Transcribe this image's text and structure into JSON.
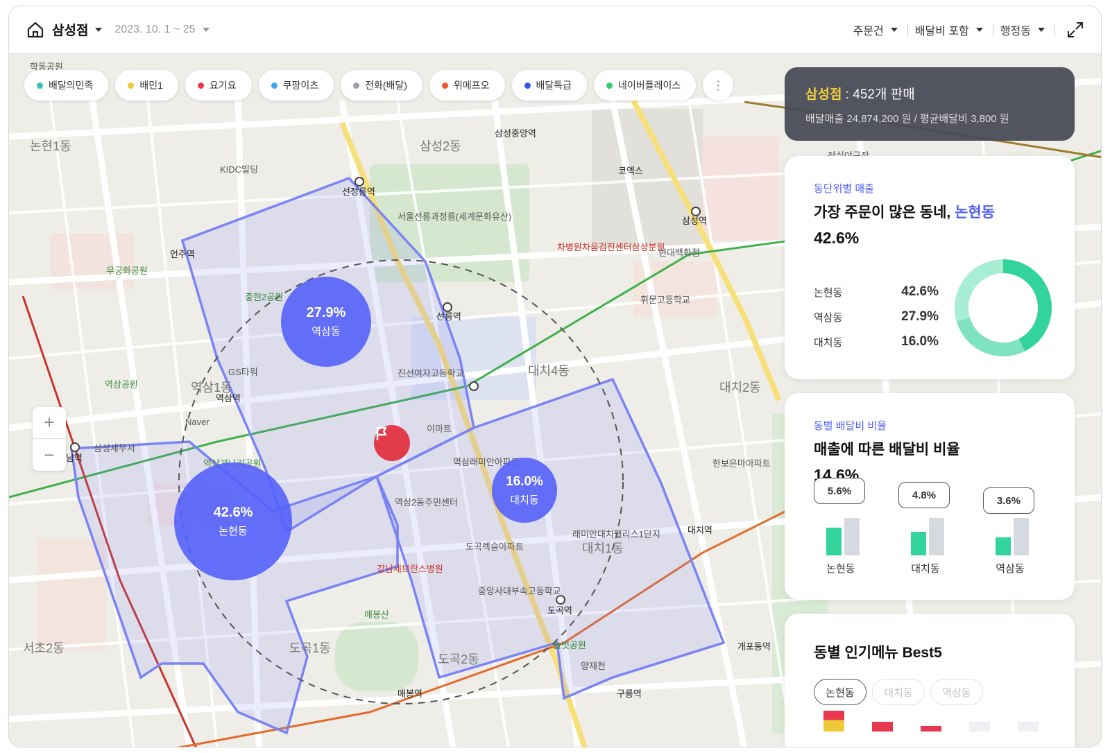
{
  "header": {
    "store": "삼성점",
    "date_range": "2023. 10. 1 ~ 25",
    "filters": [
      "주문건",
      "배달비 포함",
      "행정동"
    ]
  },
  "platforms": [
    {
      "label": "배달의민족",
      "color": "#2ec4b6"
    },
    {
      "label": "배민1",
      "color": "#f0c93a"
    },
    {
      "label": "요기요",
      "color": "#e8384f"
    },
    {
      "label": "쿠팡이츠",
      "color": "#3aa6f2"
    },
    {
      "label": "전화(배달)",
      "color": "#9aa0ad"
    },
    {
      "label": "위메프오",
      "color": "#ee5a2b"
    },
    {
      "label": "배달특급",
      "color": "#3b55e6"
    },
    {
      "label": "네이버플레이스",
      "color": "#2fcf6a"
    }
  ],
  "map": {
    "zoom_in": "+",
    "zoom_out": "−",
    "bubbles": [
      {
        "pct": "27.9%",
        "name": "역삼동"
      },
      {
        "pct": "42.6%",
        "name": "논현동"
      },
      {
        "pct": "16.0%",
        "name": "대치동"
      }
    ],
    "labels": [
      "논현1동",
      "학동공원",
      "삼성2동",
      "선정릉역",
      "삼성중앙역",
      "코엑스",
      "삼성역",
      "언주역",
      "역삼1동",
      "역삼역",
      "선릉역",
      "대치4동",
      "대치2동",
      "강남역",
      "도곡1동",
      "도곡2동",
      "대치1동",
      "대치역",
      "도곡역",
      "매봉역",
      "구룡역",
      "개포동역",
      "양재천",
      "서초2동",
      "무궁화공원",
      "충현2공원",
      "역삼공원",
      "진선여자고등학교",
      "이마트",
      "역삼래미안아파트",
      "강남세브란스병원",
      "매봉산",
      "역삼2동주민센터",
      "도곡렉슬아파트",
      "중앙사대부속고등학교",
      "한보은마아파트",
      "현대백화점",
      "휘문고등학교",
      "서울선릉과정릉(세계문화유산)",
      "차병원차움검진센터삼성분원",
      "역삼개나리공원",
      "삼성세무서",
      "Naver",
      "GS타워",
      "KIDC빌딩",
      "잠실야구장",
      "래미안대치팰리스1단지",
      "늘벗공원"
    ]
  },
  "summary": {
    "store": "삼성점",
    "sold": " : 452개 판매",
    "detail": "배달매출 24,874,200 원  /  평균배달비 3,800 원"
  },
  "sales_card": {
    "caption": "동단위별 매출",
    "headline_prefix": "가장 주문이 많은 동네, ",
    "headline_dong": "논현동",
    "big": "42.6%",
    "rows": [
      {
        "name": "논현동",
        "value": "42.6%"
      },
      {
        "name": "역삼동",
        "value": "27.9%"
      },
      {
        "name": "대치동",
        "value": "16.0%"
      }
    ],
    "donut": [
      {
        "share": 42.6,
        "color": "#33d49c"
      },
      {
        "share": 27.9,
        "color": "#7fe3bf"
      },
      {
        "share": 29.5,
        "color": "#a8eed4"
      }
    ]
  },
  "fee_card": {
    "caption": "동별 배달비 비율",
    "headline": "매출에 따른 배달비 비율",
    "big": "14.6%",
    "groups": [
      {
        "name": "논현동",
        "pct": "5.6%",
        "fee": 5.6
      },
      {
        "name": "대치동",
        "pct": "4.8%",
        "fee": 4.8
      },
      {
        "name": "역삼동",
        "pct": "3.6%",
        "fee": 3.6
      }
    ],
    "bar_colors": {
      "fee": "#33d49c",
      "rest": "#d6dae0"
    }
  },
  "menu_card": {
    "headline": "동별 인기메뉴 Best5",
    "tabs": [
      "논현동",
      "대치동",
      "역삼동"
    ]
  }
}
